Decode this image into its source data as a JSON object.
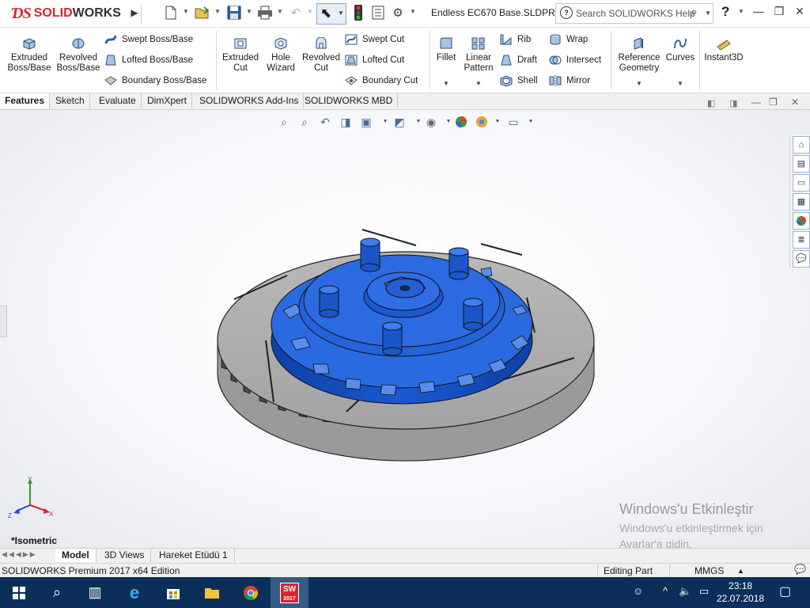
{
  "app": {
    "brand_ds": "ƊS",
    "brand_name_prefix": "SOLID",
    "brand_name_suffix": "WORKS",
    "document_title": "Endless EC670 Base.SLDPRT",
    "search_placeholder": "Search SOLIDWORKS Help",
    "help_label": "?"
  },
  "commands": {
    "extruded_boss": "Extruded\nBoss/Base",
    "revolved_boss": "Revolved\nBoss/Base",
    "swept_boss": "Swept Boss/Base",
    "lofted_boss": "Lofted Boss/Base",
    "boundary_boss": "Boundary Boss/Base",
    "extruded_cut": "Extruded\nCut",
    "hole_wizard": "Hole\nWizard",
    "revolved_cut": "Revolved\nCut",
    "swept_cut": "Swept Cut",
    "lofted_cut": "Lofted Cut",
    "boundary_cut": "Boundary Cut",
    "fillet": "Fillet",
    "linear_pattern": "Linear\nPattern",
    "rib": "Rib",
    "draft": "Draft",
    "shell": "Shell",
    "wrap": "Wrap",
    "intersect": "Intersect",
    "mirror": "Mirror",
    "reference_geometry": "Reference\nGeometry",
    "curves": "Curves",
    "instant3d": "Instant3D"
  },
  "tabs": [
    "Features",
    "Sketch",
    "Evaluate",
    "DimXpert",
    "SOLIDWORKS Add-Ins",
    "SOLIDWORKS MBD"
  ],
  "active_tab": "Features",
  "viewport": {
    "view_orientation": "*Isometric",
    "axis_labels": {
      "x": "X",
      "y": "Y",
      "z": "Z"
    },
    "activation_title": "Windows'u Etkinleştir",
    "activation_line1": "Windows'u etkinleştirmek için",
    "activation_line2": "Ayarlar'a gidin."
  },
  "model_tabs": [
    "Model",
    "3D Views",
    "Hareket Etüdü 1"
  ],
  "active_model_tab": "Model",
  "status": {
    "edition": "SOLIDWORKS Premium 2017 x64 Edition",
    "mode": "Editing Part",
    "units": "MMGS",
    "units_arrow": "▲"
  },
  "taskbar": {
    "time": "23:18",
    "date": "22.07.2018",
    "sw_badge": "SW",
    "sw_year": "2017"
  },
  "colors": {
    "brand_red": "#d8262c",
    "hub_blue": "#1e5fd6",
    "disc_gray": "#a9a9a9",
    "taskbar": "#0b2f5a"
  }
}
